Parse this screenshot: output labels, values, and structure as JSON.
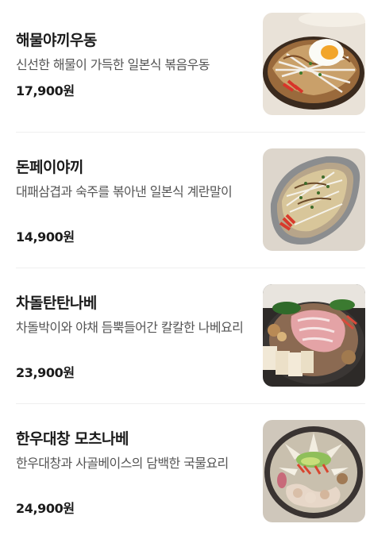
{
  "menu": {
    "items": [
      {
        "name": "해물야끼우동",
        "description": "신선한 해물이 가득한 일본식 볶음우동",
        "price": "17,900원",
        "photo_icon": "seafood-yaki-udon-photo"
      },
      {
        "name": "돈페이야끼",
        "description": "대패삼겹과 숙주를 볶아낸 일본식 계란말이",
        "price": "14,900원",
        "photo_icon": "tonpeiyaki-photo"
      },
      {
        "name": "차돌탄탄나베",
        "description": "차돌박이와 야채 듬뿍들어간 칼칼한 나베요리",
        "price": "23,900원",
        "photo_icon": "chadol-tantan-nabe-photo"
      },
      {
        "name": "한우대창 모츠나베",
        "description": "한우대창과 사골베이스의 담백한 국물요리",
        "price": "24,900원",
        "photo_icon": "hanwoo-motsunabe-photo"
      }
    ]
  }
}
